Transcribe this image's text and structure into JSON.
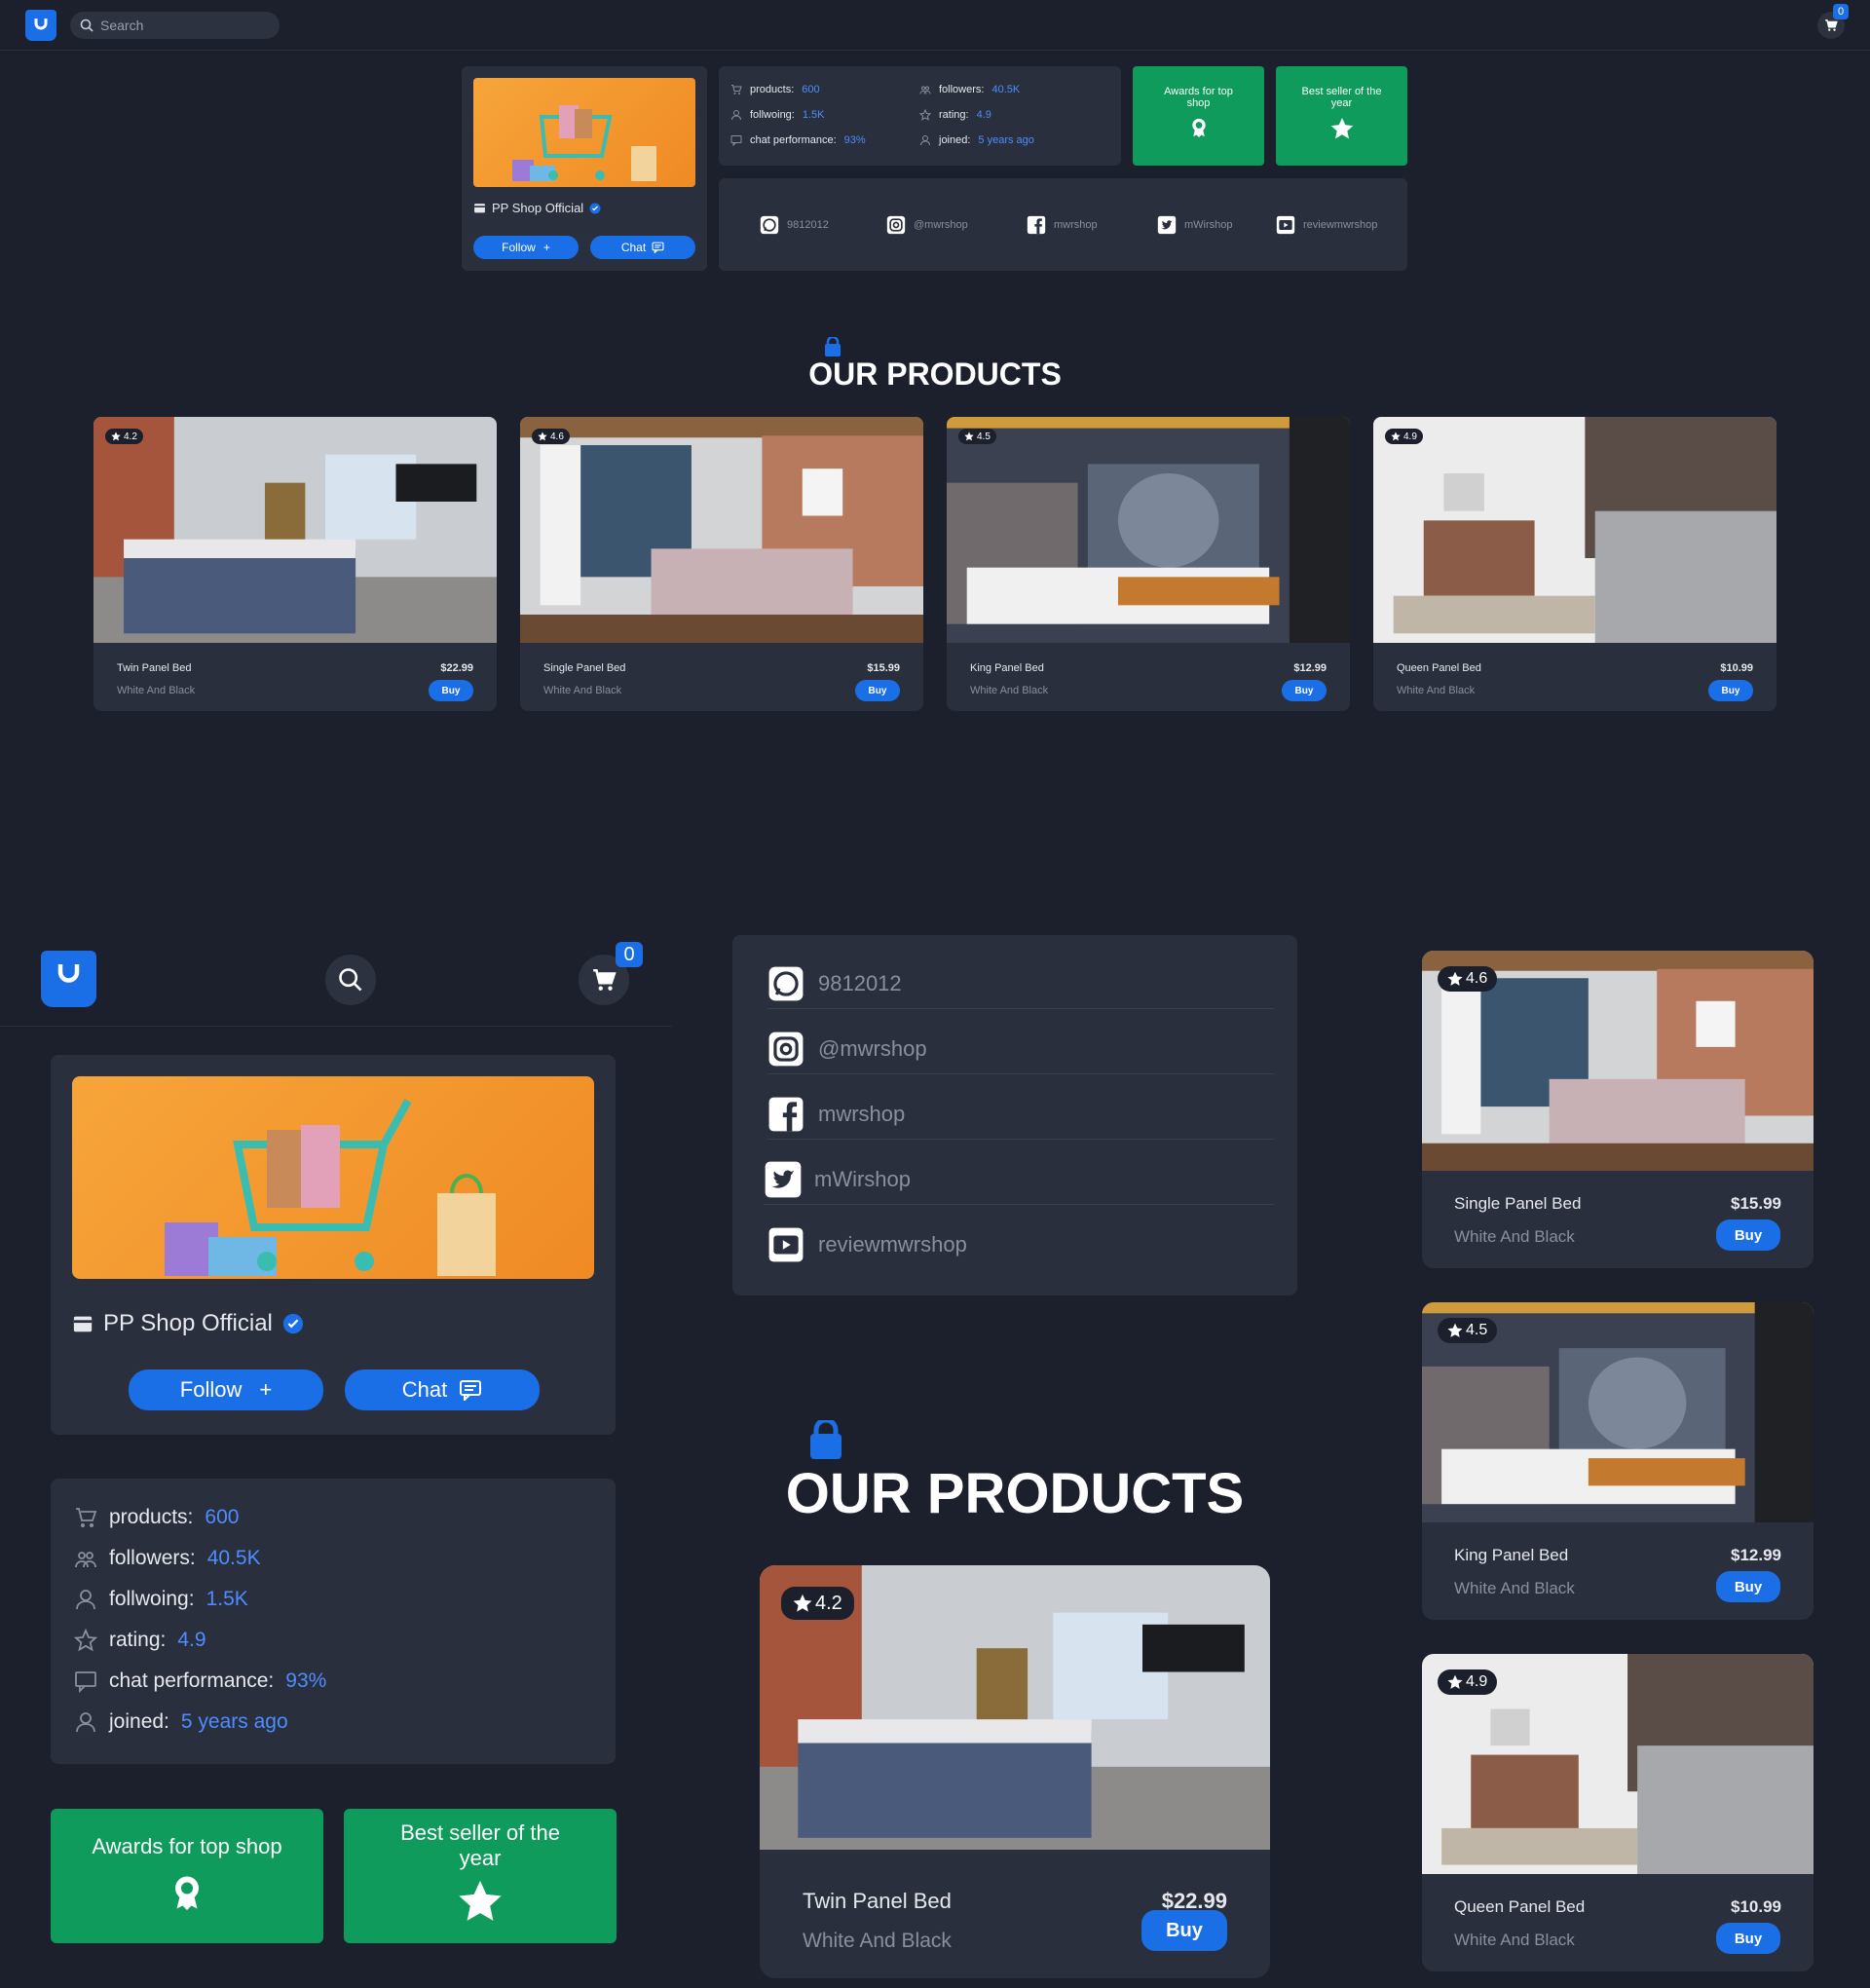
{
  "search": {
    "placeholder": "Search"
  },
  "cart": {
    "count": "0"
  },
  "shop": {
    "name": "PP Shop Official",
    "follow_label": "Follow",
    "follow_icon": "+",
    "chat_label": "Chat"
  },
  "stats": [
    {
      "label": "products:",
      "value": "600",
      "icon": "cart-icon"
    },
    {
      "label": "followers:",
      "value": "40.5K",
      "icon": "followers-icon"
    },
    {
      "label": "follwoing:",
      "value": "1.5K",
      "icon": "user-icon"
    },
    {
      "label": "rating:",
      "value": "4.9",
      "icon": "star-outline-icon"
    },
    {
      "label": "chat performance:",
      "value": "93%",
      "icon": "chat-icon"
    },
    {
      "label": "joined:",
      "value": "5 years ago",
      "icon": "user-icon"
    }
  ],
  "awards": [
    {
      "label": "Awards for top shop",
      "icon": "award-icon"
    },
    {
      "label": "Best seller of the year",
      "icon": "star-icon"
    }
  ],
  "socials": [
    {
      "icon": "whatsapp-icon",
      "label": "9812012"
    },
    {
      "icon": "instagram-icon",
      "label": "@mwrshop"
    },
    {
      "icon": "facebook-icon",
      "label": "mwrshop"
    },
    {
      "icon": "twitter-icon",
      "label": "mWirshop"
    },
    {
      "icon": "youtube-icon",
      "label": "reviewmwrshop"
    }
  ],
  "section_title": "OUR PRODUCTS",
  "products": [
    {
      "name": "Twin Panel Bed",
      "subtitle": "White And Black",
      "price": "$22.99",
      "rating": "4.2",
      "buy": "Buy"
    },
    {
      "name": "Single Panel Bed",
      "subtitle": "White And Black",
      "price": "$15.99",
      "rating": "4.6",
      "buy": "Buy"
    },
    {
      "name": "King Panel Bed",
      "subtitle": "White And Black",
      "price": "$12.99",
      "rating": "4.5",
      "buy": "Buy"
    },
    {
      "name": "Queen Panel Bed",
      "subtitle": "White And Black",
      "price": "$10.99",
      "rating": "4.9",
      "buy": "Buy"
    }
  ],
  "colors": {
    "accent": "#1b6fe6",
    "green": "#0e9b5c",
    "background": "#1c202c",
    "panel": "#2a2f3d"
  }
}
